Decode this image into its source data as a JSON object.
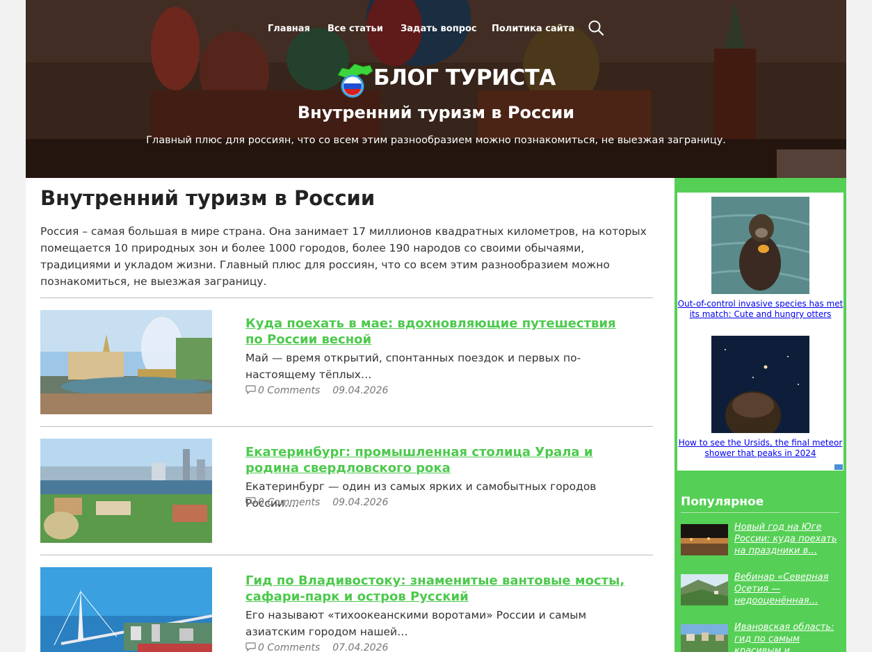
{
  "nav": {
    "items": [
      "Главная",
      "Все статьи",
      "Задать вопрос",
      "Политика сайта"
    ],
    "search_icon": "search-icon"
  },
  "header": {
    "logo_text": "БЛОГ ТУРИСТА",
    "site_title": "Внутренний туризм в России",
    "site_description": "Главный плюс для россиян, что со всем этим разнообразием можно познакомиться, не выезжая заграницу."
  },
  "main": {
    "page_title": "Внутренний туризм в России",
    "intro": "Россия – самая большая в мире страна. Она занимает 17 миллионов квадратных километров, на которых помещается 10 природных зон и более 1000 городов, более 190 народов со своими обычаями, традициями и укладом жизни. Главный плюс для россиян, что со всем этим разнообразием можно познакомиться, не выезжая заграницу.",
    "posts": [
      {
        "title": "Куда поехать в мае: вдохновляющие путешествия по России весной",
        "excerpt": "Май — время открытий, спонтанных поездок и первых по-настоящему тёплых…",
        "comments": "0 Comments",
        "date": "09.04.2026"
      },
      {
        "title": "Екатеринбург: промышленная столица Урала и родина свердловского рока",
        "excerpt": "Екатеринбург — один из самых ярких и самобытных городов России.…",
        "comments": "0 Comments",
        "date": "09.04.2026"
      },
      {
        "title": "Гид по Владивостоку: знаменитые вантовые мосты, сафари-парк и остров Русский",
        "excerpt": "Его называют «тихоокеанскими воротами» России и самым азиатским городом нашей…",
        "comments": "0 Comments",
        "date": "07.04.2026"
      }
    ]
  },
  "sidebar": {
    "ads": [
      {
        "caption": "Out-of-control invasive species has met its match: Cute and hungry otters"
      },
      {
        "caption": "How to see the Ursids, the final meteor shower that peaks in 2024"
      }
    ],
    "popular_title": "Популярное",
    "popular": [
      {
        "title": "Новый год на Юге России: куда поехать на праздники в…"
      },
      {
        "title": "Вебинар «Северная Осетия — недооценённая…"
      },
      {
        "title": "Ивановская область: гид по самым красивым и интересным места…"
      }
    ]
  },
  "colors": {
    "accent_green": "#4dc94d",
    "sidebar_green": "#55cf55",
    "link_blue": "#0000ee"
  }
}
